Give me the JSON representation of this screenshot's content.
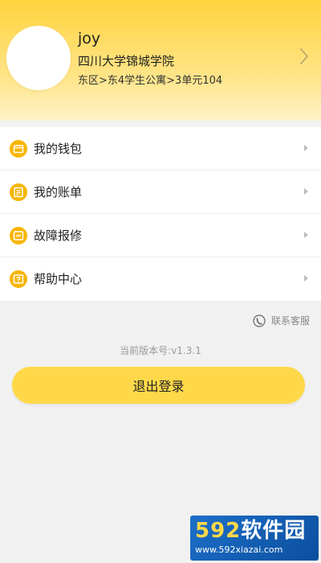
{
  "profile": {
    "name": "joy",
    "school": "四川大学锦城学院",
    "address": "东区>东4学生公寓>3单元104"
  },
  "menu": {
    "items": [
      {
        "label": "我的钱包",
        "icon": "wallet-icon"
      },
      {
        "label": "我的账单",
        "icon": "bill-icon"
      },
      {
        "label": "故障报修",
        "icon": "repair-icon"
      },
      {
        "label": "帮助中心",
        "icon": "help-icon"
      }
    ]
  },
  "contact": {
    "label": "联系客服",
    "icon": "phone-icon"
  },
  "version": {
    "text": "当前版本号:v1.3.1"
  },
  "logout": {
    "label": "退出登录"
  },
  "watermark": {
    "logo_num": "592",
    "logo_text": "软件园",
    "url": "www.592xiazai.com"
  },
  "colors": {
    "accent": "#ffd84a",
    "header_gradient_top": "#ffd33d",
    "icon_orange": "#f7b500",
    "background": "#f1f1f1"
  }
}
